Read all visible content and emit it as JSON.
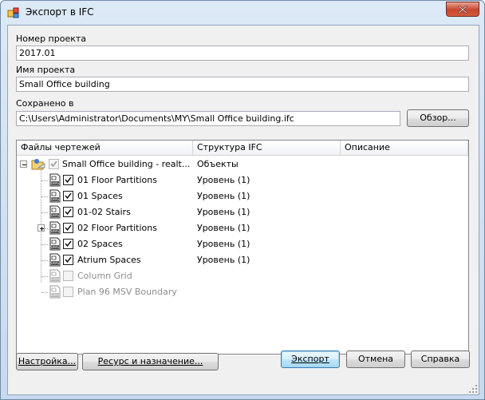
{
  "window": {
    "title": "Экспорт в IFC"
  },
  "form": {
    "project_number_label": "Номер проекта",
    "project_number_value": "2017.01",
    "project_name_label": "Имя проекта",
    "project_name_value": "Small Office building",
    "saved_to_label": "Сохранено в",
    "saved_to_value": "C:\\Users\\Administrator\\Documents\\MY\\Small Office building.ifc",
    "browse_button": "Обзор..."
  },
  "grid": {
    "columns": [
      "Файлы чертежей",
      "Структура IFC",
      "Описание"
    ],
    "root": {
      "name": "Small Office building - realt...",
      "ifc": "Объекты",
      "checked": true
    },
    "rows": [
      {
        "name": "01 Floor Partitions",
        "ifc": "Уровень (1)",
        "checked": true,
        "enabled": true,
        "expandable": false
      },
      {
        "name": "01 Spaces",
        "ifc": "Уровень (1)",
        "checked": true,
        "enabled": true,
        "expandable": false
      },
      {
        "name": "01-02 Stairs",
        "ifc": "Уровень (1)",
        "checked": true,
        "enabled": true,
        "expandable": false
      },
      {
        "name": "02 Floor Partitions",
        "ifc": "Уровень (1)",
        "checked": true,
        "enabled": true,
        "expandable": true
      },
      {
        "name": "02 Spaces",
        "ifc": "Уровень (1)",
        "checked": true,
        "enabled": true,
        "expandable": false
      },
      {
        "name": "Atrium Spaces",
        "ifc": "Уровень (1)",
        "checked": true,
        "enabled": true,
        "expandable": false
      },
      {
        "name": "Column Grid",
        "ifc": "",
        "checked": false,
        "enabled": false,
        "expandable": false
      },
      {
        "name": "Plan 96 MSV Boundary",
        "ifc": "",
        "checked": false,
        "enabled": false,
        "expandable": false
      }
    ]
  },
  "buttons": {
    "settings": "Настройка...",
    "resource": "Ресурс и назначение...",
    "export": "Экспорт",
    "cancel": "Отмена",
    "help": "Справка"
  }
}
